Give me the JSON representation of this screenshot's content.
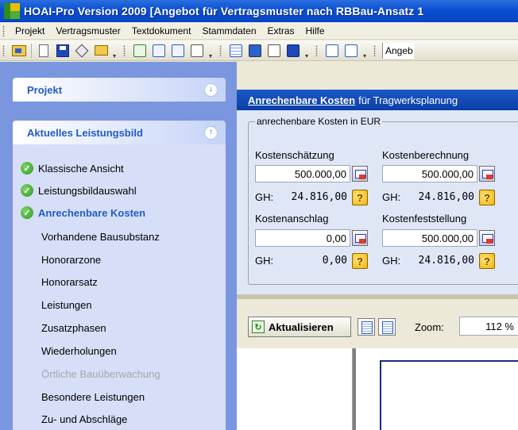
{
  "window": {
    "title": "HOAI-Pro Version 2009  [Angebot für Vertragsmuster nach RBBau-Ansatz 1"
  },
  "menubar": {
    "items": [
      "Projekt",
      "Vertragsmuster",
      "Textdokument",
      "Stammdaten",
      "Extras",
      "Hilfe"
    ]
  },
  "toolbar": {
    "combo_text": "Angeb"
  },
  "sidebar": {
    "projekt_label": "Projekt",
    "leistungsbild_label": "Aktuelles Leistungsbild",
    "done_items": [
      "Klassische Ansicht",
      "Leistungsbildauswahl"
    ],
    "active_item": "Anrechenbare Kosten",
    "items": [
      "Vorhandene Bausubstanz",
      "Honorarzone",
      "Honorarsatz",
      "Leistungen",
      "Zusatzphasen",
      "Wiederholungen"
    ],
    "disabled_item": "Örtliche Bauüberwachung",
    "items_after": [
      "Besondere Leistungen",
      "Zu- und Abschläge"
    ]
  },
  "main": {
    "header_title": "Anrechenbare Kosten",
    "header_sub": "für Tragwerksplanung",
    "group_legend": "anrechenbare Kosten in EUR",
    "gh_label": "GH:",
    "fields": {
      "schaetzung": {
        "label": "Kostenschätzung",
        "value": "500.000,00",
        "gh": "24.816,00"
      },
      "berechnung": {
        "label": "Kostenberechnung",
        "value": "500.000,00",
        "gh": "24.816,00"
      },
      "anschlag": {
        "label": "Kostenanschlag",
        "value": "0,00",
        "gh": "0,00"
      },
      "feststellung": {
        "label": "Kostenfeststellung",
        "value": "500.000,00",
        "gh": "24.816,00"
      }
    },
    "help_glyph": "?"
  },
  "preview_toolbar": {
    "refresh_label": "Aktualisieren",
    "zoom_label": "Zoom:",
    "zoom_value": "112 %"
  },
  "colors": {
    "titlebar": "#0a4fd0",
    "sidebar_bg": "#7a96df",
    "panel_body": "#d6dff7",
    "accent_text": "#215dc6",
    "main_header": "#1d57c8"
  }
}
